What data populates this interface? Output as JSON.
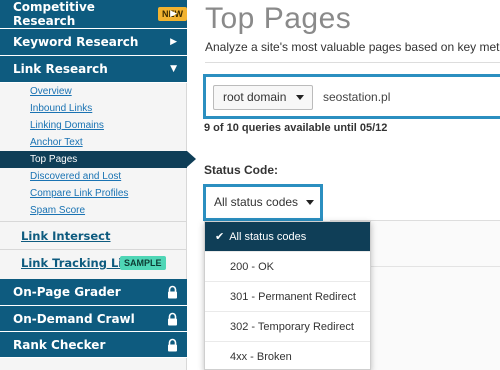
{
  "sidebar": {
    "competitive_research": {
      "label": "Competitive Research",
      "badge": "NEW"
    },
    "keyword_research": {
      "label": "Keyword Research"
    },
    "link_research": {
      "label": "Link Research",
      "items": [
        "Overview",
        "Inbound Links",
        "Linking Domains",
        "Anchor Text",
        "Top Pages",
        "Discovered and Lost",
        "Compare Link Profiles",
        "Spam Score"
      ],
      "active_index": 4
    },
    "link_intersect": {
      "label": "Link Intersect"
    },
    "link_tracking": {
      "label": "Link Tracking Lists",
      "badge": "SAMPLE"
    },
    "locked_tools": [
      {
        "label": "On-Page Grader"
      },
      {
        "label": "On-Demand Crawl"
      },
      {
        "label": "Rank Checker"
      }
    ],
    "icons": {
      "expand": "chevron-right-icon",
      "collapse": "chevron-down-icon",
      "locked": "lock-icon"
    }
  },
  "main": {
    "title": "Top Pages",
    "subtitle": "Analyze a site's most valuable pages based on key metrics.",
    "query": {
      "scope": "root domain",
      "value": "seostation.pl"
    },
    "queries_note": "9 of 10 queries available until 05/12",
    "status": {
      "label": "Status Code:",
      "selected": "All status codes",
      "options": [
        "All status codes",
        "200 - OK",
        "301 - Permanent Redirect",
        "302 - Temporary Redirect",
        "4xx - Broken"
      ]
    }
  },
  "colors": {
    "nav_primary": "#0e5b7f",
    "nav_active": "#0f3e57",
    "accent_border": "#2b8fc0",
    "badge_new": "#f2b330",
    "badge_sample": "#4fd6b6",
    "link": "#1a73b3"
  }
}
